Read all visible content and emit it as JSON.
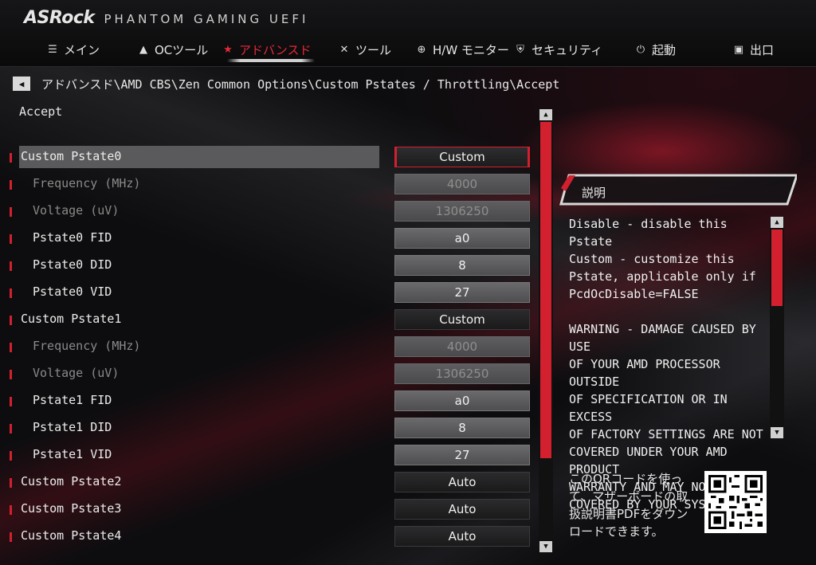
{
  "brand": {
    "logo": "ASRock",
    "product": "PHANTOM GAMING UEFI"
  },
  "nav": [
    {
      "label": "メイン",
      "icon": "list-icon"
    },
    {
      "label": "OCツール",
      "icon": "rocket-icon"
    },
    {
      "label": "アドバンスド",
      "icon": "star-icon",
      "active": true
    },
    {
      "label": "ツール",
      "icon": "tools-icon"
    },
    {
      "label": "H/W モニター",
      "icon": "crosshair-icon"
    },
    {
      "label": "セキュリティ",
      "icon": "shield-icon"
    },
    {
      "label": "起動",
      "icon": "power-icon"
    },
    {
      "label": "出口",
      "icon": "exit-icon"
    }
  ],
  "breadcrumb": "アドバンスド\\AMD CBS\\Zen Common Options\\Custom Pstates / Throttling\\Accept",
  "page_title": "Accept",
  "settings": [
    {
      "label": "Custom Pstate0",
      "value": "Custom"
    },
    {
      "label": "Frequency (MHz)",
      "value": "4000"
    },
    {
      "label": "Voltage (uV)",
      "value": "1306250"
    },
    {
      "label": "Pstate0 FID",
      "value": "a0"
    },
    {
      "label": "Pstate0 DID",
      "value": "8"
    },
    {
      "label": "Pstate0 VID",
      "value": "27"
    },
    {
      "label": "Custom Pstate1",
      "value": "Custom"
    },
    {
      "label": "Frequency (MHz)",
      "value": "4000"
    },
    {
      "label": "Voltage (uV)",
      "value": "1306250"
    },
    {
      "label": "Pstate1 FID",
      "value": "a0"
    },
    {
      "label": "Pstate1 DID",
      "value": "8"
    },
    {
      "label": "Pstate1 VID",
      "value": "27"
    },
    {
      "label": "Custom Pstate2",
      "value": "Auto"
    },
    {
      "label": "Custom Pstate3",
      "value": "Auto"
    },
    {
      "label": "Custom Pstate4",
      "value": "Auto"
    }
  ],
  "help": {
    "title": "説明",
    "text": "Disable - disable this Pstate\nCustom - customize this\nPstate, applicable only if\nPcdOcDisable=FALSE\n\nWARNING - DAMAGE CAUSED BY USE\nOF YOUR AMD PROCESSOR OUTSIDE\nOF SPECIFICATION OR IN EXCESS\nOF FACTORY SETTINGS ARE NOT\nCOVERED UNDER YOUR AMD PRODUCT\nWARRANTY AND MAY NOT BE\nCOVERED BY YOUR SYSTEM"
  },
  "qr_caption": "このQRコードを使って、マザーボードの取扱説明書PDFをダウンロードできます。",
  "colors": {
    "accent": "#d2202f",
    "background": "#0b0b0c"
  }
}
